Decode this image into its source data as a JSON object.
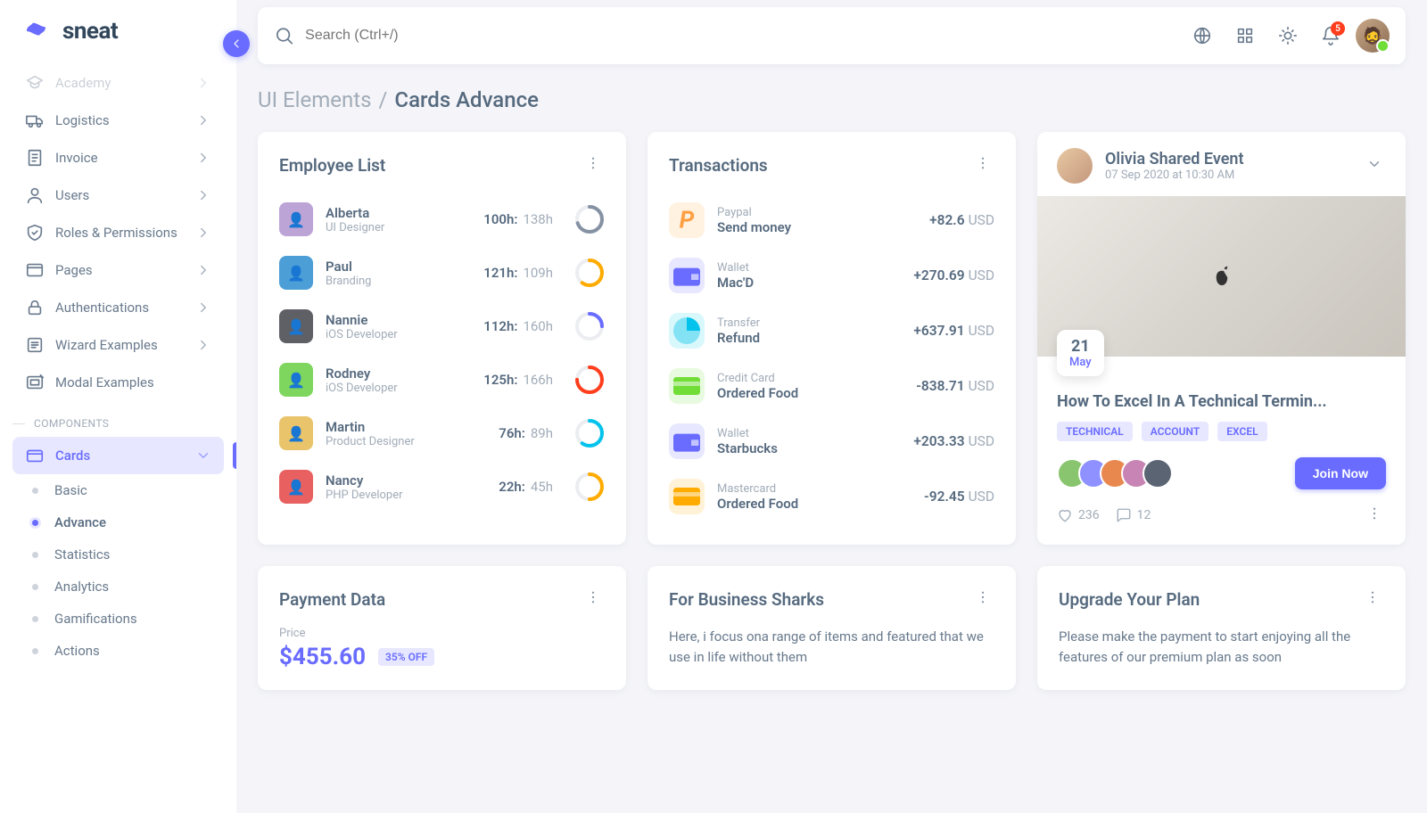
{
  "brand": "sneat",
  "search": {
    "placeholder": "Search (Ctrl+/)"
  },
  "notifications": {
    "count": "5"
  },
  "breadcrumb": {
    "parent": "UI Elements",
    "sep": "/",
    "current": "Cards Advance"
  },
  "sidebar": {
    "items": [
      {
        "label": "Academy",
        "fade": true,
        "chevron": true,
        "icon": "cap"
      },
      {
        "label": "Logistics",
        "chevron": true,
        "icon": "truck"
      },
      {
        "label": "Invoice",
        "chevron": true,
        "icon": "file"
      },
      {
        "label": "Users",
        "chevron": true,
        "icon": "user"
      },
      {
        "label": "Roles & Permissions",
        "chevron": true,
        "icon": "shield"
      },
      {
        "label": "Pages",
        "chevron": true,
        "icon": "window"
      },
      {
        "label": "Authentications",
        "chevron": true,
        "icon": "lock"
      },
      {
        "label": "Wizard Examples",
        "chevron": true,
        "icon": "list"
      },
      {
        "label": "Modal Examples",
        "chevron": false,
        "icon": "modal"
      }
    ],
    "section": "COMPONENTS",
    "cards": {
      "label": "Cards"
    },
    "subitems": [
      {
        "label": "Basic"
      },
      {
        "label": "Advance",
        "current": true
      },
      {
        "label": "Statistics"
      },
      {
        "label": "Analytics"
      },
      {
        "label": "Gamifications"
      },
      {
        "label": "Actions"
      }
    ]
  },
  "employee": {
    "title": "Employee List",
    "rows": [
      {
        "name": "Alberta",
        "role": "UI Designer",
        "h1": "100h:",
        "h2": "138h",
        "color": "#8592a3",
        "pct": 70,
        "bg": "#bda4d6"
      },
      {
        "name": "Paul",
        "role": "Branding",
        "h1": "121h:",
        "h2": "109h",
        "color": "#ffab00",
        "pct": 60,
        "bg": "#4b9ed6"
      },
      {
        "name": "Nannie",
        "role": "iOS Developer",
        "h1": "112h:",
        "h2": "160h",
        "color": "#696cff",
        "pct": 25,
        "bg": "#5f6066"
      },
      {
        "name": "Rodney",
        "role": "iOS Developer",
        "h1": "125h:",
        "h2": "166h",
        "color": "#ff3e1d",
        "pct": 75,
        "bg": "#7fd65e"
      },
      {
        "name": "Martin",
        "role": "Product Designer",
        "h1": "76h:",
        "h2": "89h",
        "color": "#03c3ec",
        "pct": 60,
        "bg": "#e9c46a"
      },
      {
        "name": "Nancy",
        "role": "PHP Developer",
        "h1": "22h:",
        "h2": "45h",
        "color": "#ffab00",
        "pct": 50,
        "bg": "#e86060"
      }
    ]
  },
  "transactions": {
    "title": "Transactions",
    "rows": [
      {
        "sub": "Paypal",
        "main": "Send money",
        "amt": "+82.6",
        "cur": "USD",
        "bg": "#fff2e1",
        "fg": "#ff9f43",
        "glyph": "P"
      },
      {
        "sub": "Wallet",
        "main": "Mac'D",
        "amt": "+270.69",
        "cur": "USD",
        "bg": "#e7e7ff",
        "fg": "#696cff",
        "glyph": "wallet"
      },
      {
        "sub": "Transfer",
        "main": "Refund",
        "amt": "+637.91",
        "cur": "USD",
        "bg": "#d9f8fc",
        "fg": "#03c3ec",
        "glyph": "chart"
      },
      {
        "sub": "Credit Card",
        "main": "Ordered Food",
        "amt": "-838.71",
        "cur": "USD",
        "bg": "#e8fadf",
        "fg": "#71dd37",
        "glyph": "card"
      },
      {
        "sub": "Wallet",
        "main": "Starbucks",
        "amt": "+203.33",
        "cur": "USD",
        "bg": "#e7e7ff",
        "fg": "#696cff",
        "glyph": "wallet"
      },
      {
        "sub": "Mastercard",
        "main": "Ordered Food",
        "amt": "-92.45",
        "cur": "USD",
        "bg": "#fff2d6",
        "fg": "#ffab00",
        "glyph": "card"
      }
    ]
  },
  "event": {
    "author": "Olivia Shared Event",
    "timestamp": "07 Sep 2020 at 10:30 AM",
    "day": "21",
    "month": "May",
    "title": "How To Excel In A Technical Termin...",
    "tags": [
      "TECHNICAL",
      "ACCOUNT",
      "EXCEL"
    ],
    "join": "Join Now",
    "likes": "236",
    "comments": "12",
    "stackColors": [
      "#88c56e",
      "#8e91ff",
      "#e8884f",
      "#c784b4",
      "#5a6472"
    ]
  },
  "payment": {
    "title": "Payment Data",
    "priceLabel": "Price",
    "price": "$455.60",
    "off": "35% OFF"
  },
  "business": {
    "title": "For Business Sharks",
    "body": "Here, i focus ona range of items and featured that we use in life without them"
  },
  "upgrade": {
    "title": "Upgrade Your Plan",
    "body": "Please make the payment to start enjoying all the features of our premium plan as soon"
  }
}
